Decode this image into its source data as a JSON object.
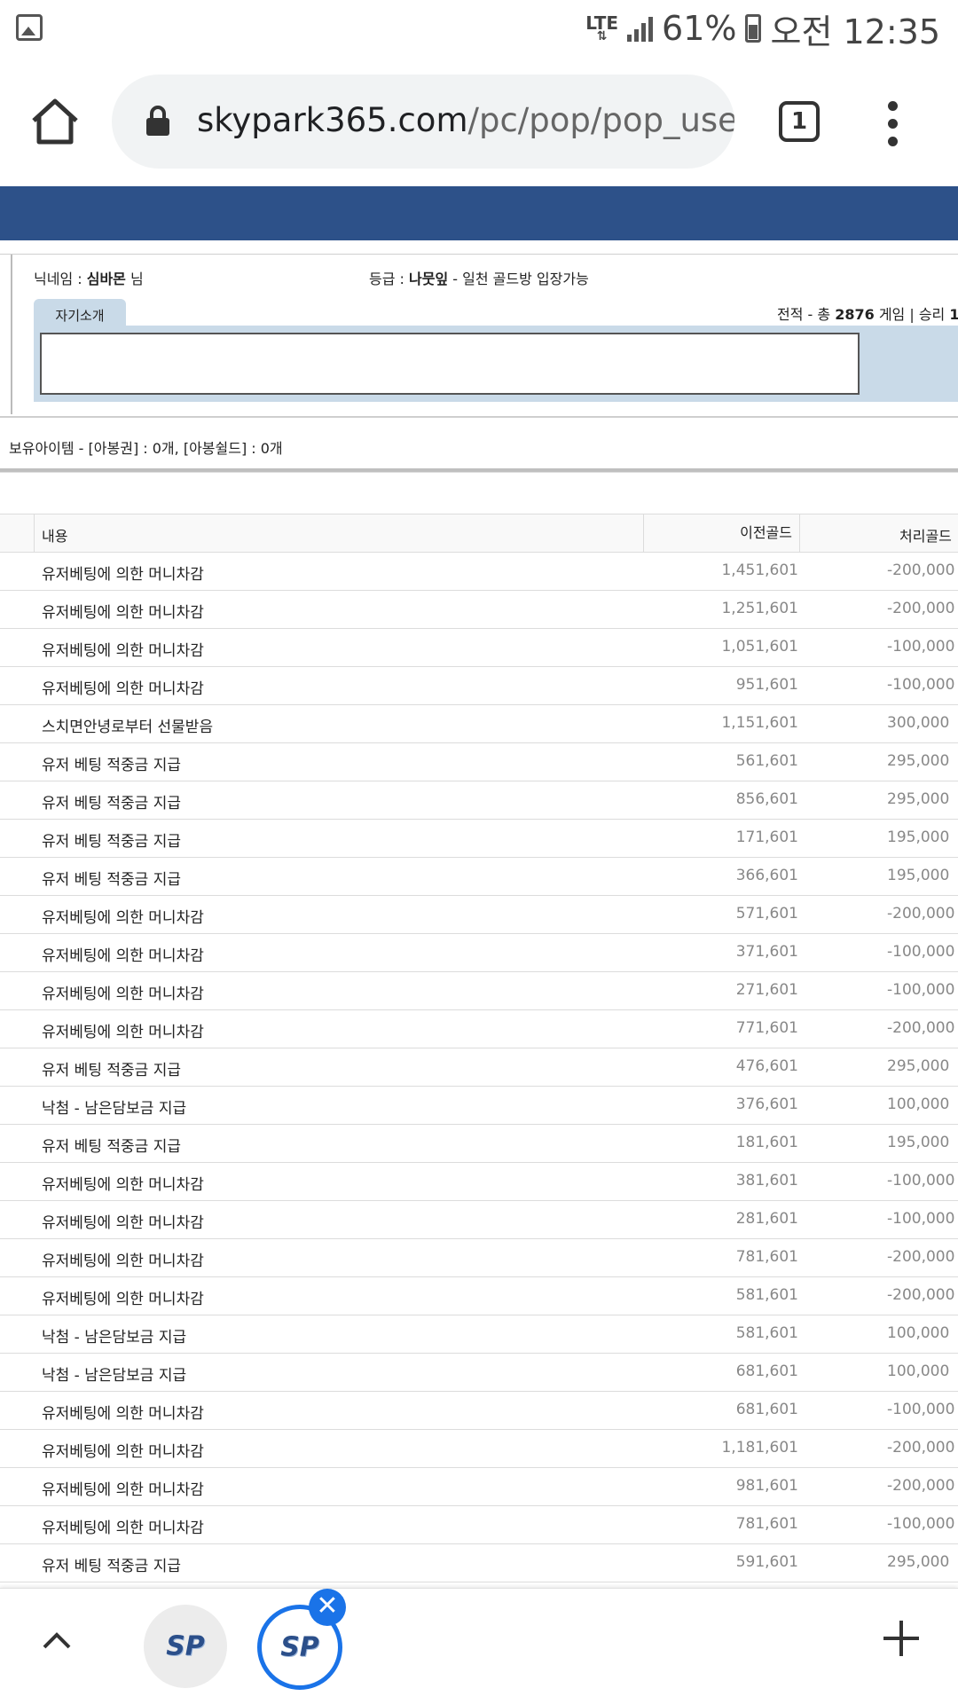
{
  "status_bar": {
    "network": "LTE",
    "battery": "61%",
    "time": "오전 12:35",
    "icons": [
      "image-icon",
      "signal-icon",
      "battery-icon"
    ]
  },
  "browser": {
    "url_domain": "skypark365.com",
    "url_path": "/pc/pop/pop_user_info",
    "tab_count": "1"
  },
  "profile": {
    "nickname_label": "닉네임 : ",
    "nickname": "심바몬",
    "nickname_suffix": " 님",
    "grade_label": "등급 : ",
    "grade": "나뭇잎",
    "grade_suffix": " - 일천 골드방 입장가능",
    "intro_tab": "자기소개",
    "record_prefix": "전적 - 총 ",
    "record_total": "2876",
    "record_mid": " 게임 | 승리 ",
    "record_wins_partial": "1"
  },
  "items_line": "보유아이템 - [아봉권] : 0개, [아봉쉴드] : 0개",
  "table": {
    "headers": [
      "내용",
      "이전골드",
      "처리골드"
    ],
    "rows": [
      {
        "desc": "유저베팅에 의한 머니차감",
        "prev": "1,451,601",
        "amount": "-200,000"
      },
      {
        "desc": "유저베팅에 의한 머니차감",
        "prev": "1,251,601",
        "amount": "-200,000"
      },
      {
        "desc": "유저베팅에 의한 머니차감",
        "prev": "1,051,601",
        "amount": "-100,000"
      },
      {
        "desc": "유저베팅에 의한 머니차감",
        "prev": "951,601",
        "amount": "-100,000"
      },
      {
        "desc": "스치면안녕로부터 선물받음",
        "prev": "1,151,601",
        "amount": "300,000"
      },
      {
        "desc": "유저 베팅 적중금 지급",
        "prev": "561,601",
        "amount": "295,000"
      },
      {
        "desc": "유저 베팅 적중금 지급",
        "prev": "856,601",
        "amount": "295,000"
      },
      {
        "desc": "유저 베팅 적중금 지급",
        "prev": "171,601",
        "amount": "195,000"
      },
      {
        "desc": "유저 베팅 적중금 지급",
        "prev": "366,601",
        "amount": "195,000"
      },
      {
        "desc": "유저베팅에 의한 머니차감",
        "prev": "571,601",
        "amount": "-200,000"
      },
      {
        "desc": "유저베팅에 의한 머니차감",
        "prev": "371,601",
        "amount": "-100,000"
      },
      {
        "desc": "유저베팅에 의한 머니차감",
        "prev": "271,601",
        "amount": "-100,000"
      },
      {
        "desc": "유저베팅에 의한 머니차감",
        "prev": "771,601",
        "amount": "-200,000"
      },
      {
        "desc": "유저 베팅 적중금 지급",
        "prev": "476,601",
        "amount": "295,000"
      },
      {
        "desc": "낙첨 - 남은담보금 지급",
        "prev": "376,601",
        "amount": "100,000"
      },
      {
        "desc": "유저 베팅 적중금 지급",
        "prev": "181,601",
        "amount": "195,000"
      },
      {
        "desc": "유저베팅에 의한 머니차감",
        "prev": "381,601",
        "amount": "-100,000"
      },
      {
        "desc": "유저베팅에 의한 머니차감",
        "prev": "281,601",
        "amount": "-100,000"
      },
      {
        "desc": "유저베팅에 의한 머니차감",
        "prev": "781,601",
        "amount": "-200,000"
      },
      {
        "desc": "유저베팅에 의한 머니차감",
        "prev": "581,601",
        "amount": "-200,000"
      },
      {
        "desc": "낙첨 - 남은담보금 지급",
        "prev": "581,601",
        "amount": "100,000"
      },
      {
        "desc": "낙첨 - 남은담보금 지급",
        "prev": "681,601",
        "amount": "100,000"
      },
      {
        "desc": "유저베팅에 의한 머니차감",
        "prev": "681,601",
        "amount": "-100,000"
      },
      {
        "desc": "유저베팅에 의한 머니차감",
        "prev": "1,181,601",
        "amount": "-200,000"
      },
      {
        "desc": "유저베팅에 의한 머니차감",
        "prev": "981,601",
        "amount": "-200,000"
      },
      {
        "desc": "유저베팅에 의한 머니차감",
        "prev": "781,601",
        "amount": "-100,000"
      },
      {
        "desc": "유저 베팅 적중금 지급",
        "prev": "591,601",
        "amount": "295,000"
      }
    ]
  },
  "bottom_bar": {
    "tab_icon_text": "SP",
    "close_badge": "✕"
  }
}
